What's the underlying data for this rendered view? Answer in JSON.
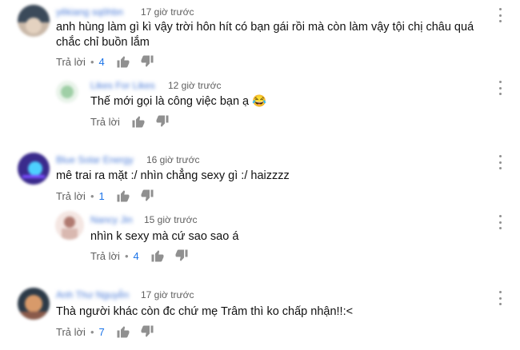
{
  "comments": [
    {
      "author": "yêkiang sqôhbn",
      "timestamp": "17 giờ trước",
      "text": "anh hùng làm gì kì vậy trời hôn hít có bạn gái rồi mà còn làm vậy tội chị châu quá chắc chỉ buồn lắm",
      "reply_label": "Trả lời",
      "like_count": "4",
      "avatar_colors": [
        "#3b4a5a",
        "#c9b8a8"
      ],
      "replies": [
        {
          "author": "Likes For Likes",
          "timestamp": "12 giờ trước",
          "text": "Thế mới gọi là công việc bạn ạ 😂",
          "reply_label": "Trả lời",
          "like_count": "",
          "avatar_colors": [
            "#e9f3ea",
            "#9fcfa6"
          ]
        }
      ]
    },
    {
      "author": "Blue Solar Energy",
      "timestamp": "16 giờ trước",
      "text": "mê trai ra mặt :/ nhìn chẳng sexy gì :/ haizzzz",
      "reply_label": "Trả lời",
      "like_count": "1",
      "avatar_colors": [
        "#3a2a8c",
        "#4dd0ff"
      ],
      "replies": [
        {
          "author": "Nancy Jin",
          "timestamp": "15 giờ trước",
          "text": "nhìn k sexy mà cứ sao sao á",
          "reply_label": "Trả lời",
          "like_count": "4",
          "avatar_colors": [
            "#f4e6e2",
            "#b07a70"
          ]
        }
      ]
    },
    {
      "author": "Anh Thư Nguyễn",
      "timestamp": "17 giờ trước",
      "text": "Thà người khác còn đc chứ mẹ Trâm thì ko chấp nhận!!:<",
      "reply_label": "Trả lời",
      "like_count": "7",
      "avatar_colors": [
        "#2c3a48",
        "#d89a6a"
      ],
      "replies": []
    }
  ],
  "colors": {
    "author_blurred": "#4a7bd8",
    "like_count": "#1a73e8",
    "meta_text": "#606060",
    "icon": "#909090"
  },
  "icons": {
    "like": "thumbs-up-icon",
    "dislike": "thumbs-down-icon",
    "menu": "kebab-menu-icon"
  }
}
